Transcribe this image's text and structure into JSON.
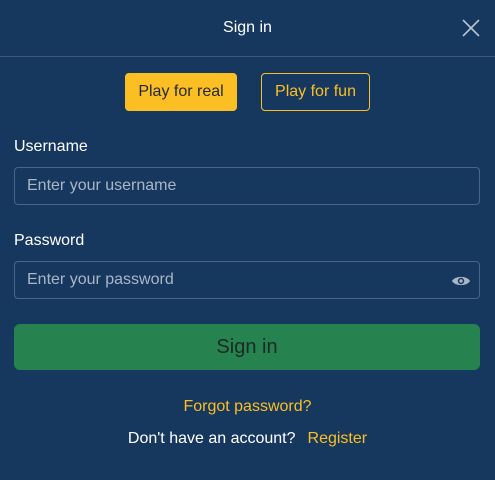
{
  "header": {
    "title": "Sign in",
    "close_icon": "close-icon"
  },
  "modes": {
    "real_label": "Play for real",
    "fun_label": "Play for fun",
    "selected": "real"
  },
  "username": {
    "label": "Username",
    "placeholder": "Enter your username",
    "value": ""
  },
  "password": {
    "label": "Password",
    "placeholder": "Enter your password",
    "value": "",
    "toggle_icon": "eye-icon"
  },
  "actions": {
    "submit_label": "Sign in",
    "forgot_label": "Forgot password?",
    "no_account_text": "Don't have an account?",
    "register_label": "Register"
  },
  "colors": {
    "background": "#17385e",
    "accent": "#fbbf24",
    "submit": "#268350",
    "border": "#4a6585"
  }
}
